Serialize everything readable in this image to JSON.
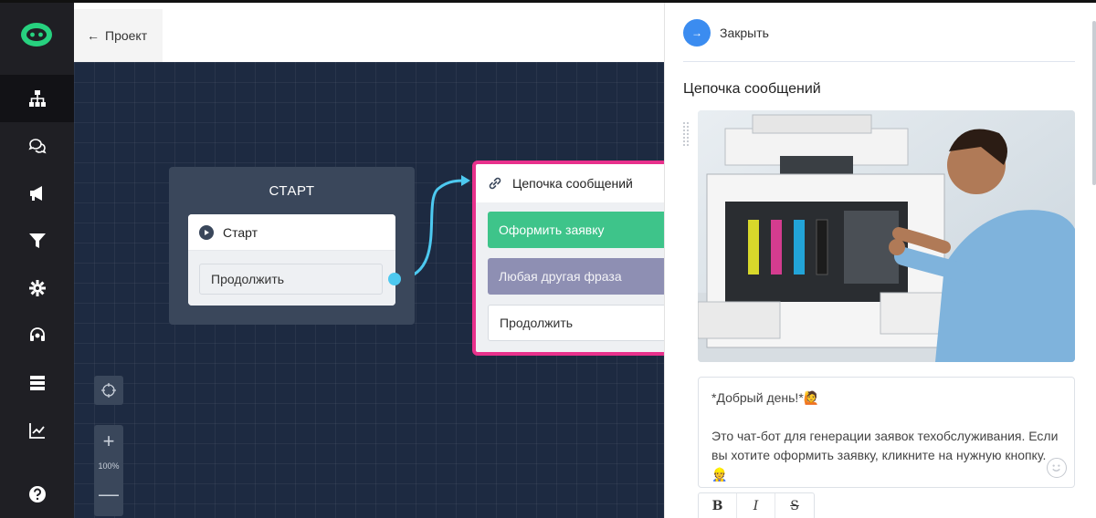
{
  "header": {
    "back_label": "Проект",
    "back_arrow": "←"
  },
  "sidebar": {
    "logo": "bot-logo",
    "items": [
      {
        "icon": "sitemap-icon",
        "active": true
      },
      {
        "icon": "chat-icon",
        "active": false
      },
      {
        "icon": "megaphone-icon",
        "active": false
      },
      {
        "icon": "filter-icon",
        "active": false
      },
      {
        "icon": "gear-icon",
        "active": false
      },
      {
        "icon": "support-icon",
        "active": false
      },
      {
        "icon": "database-icon",
        "active": false
      },
      {
        "icon": "chart-icon",
        "active": false
      },
      {
        "icon": "help-icon",
        "active": false
      }
    ]
  },
  "canvas": {
    "start_group_title": "СТАРТ",
    "start_card_title": "Старт",
    "start_button": "Продолжить",
    "chain_card_title": "Цепочка сообщений",
    "chain_buttons": [
      "Оформить заявку",
      "Любая другая фраза",
      "Продолжить"
    ],
    "zoom_plus": "+",
    "zoom_level": "100%",
    "zoom_minus": "—"
  },
  "panel": {
    "close_label": "Закрыть",
    "title": "Цепочка сообщений",
    "message_line1": "*Добрый день!*🙋",
    "message_line2": "Это чат-бот для генерации заявок техобслуживания. Если вы хотите оформить заявку, кликните на нужную кнопку.👷",
    "format_buttons": [
      "B",
      "I",
      "S"
    ]
  },
  "colors": {
    "sidebar_bg": "#1f1f24",
    "canvas_bg": "#1d2a41",
    "accent_blue": "#3b8cf0",
    "chain_border": "#e8318c",
    "button_green": "#3ec48a",
    "button_purple": "#8e8fb3",
    "connector": "#4dc9f0",
    "logo_green": "#27d17f"
  }
}
